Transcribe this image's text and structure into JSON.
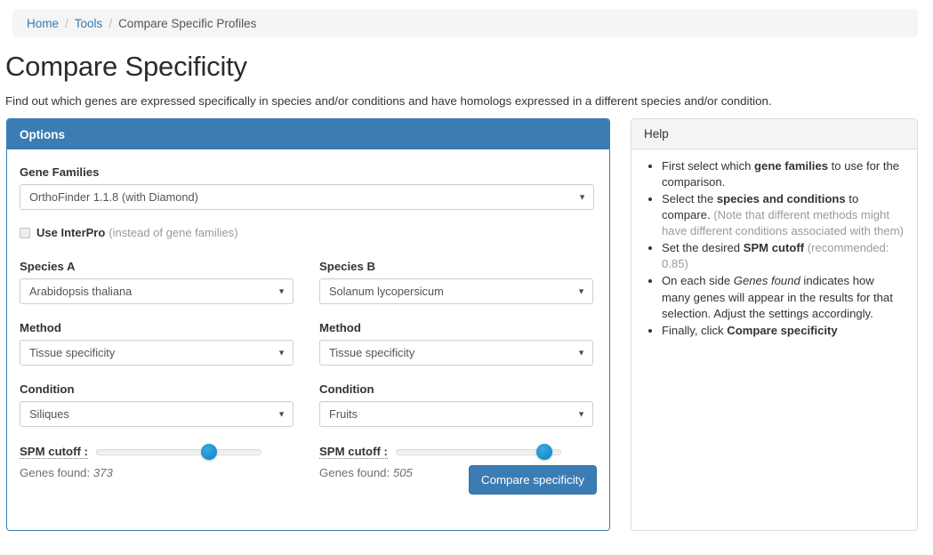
{
  "breadcrumb": {
    "home": "Home",
    "tools": "Tools",
    "current": "Compare Specific Profiles",
    "separator": "/"
  },
  "page": {
    "title": "Compare Specificity",
    "description": "Find out which genes are expressed specifically in species and/or conditions and have homologs expressed in a different species and/or condition."
  },
  "options": {
    "header": "Options",
    "gene_families": {
      "label": "Gene Families",
      "value": "OrthoFinder 1.1.8 (with Diamond)"
    },
    "interpro": {
      "label": "Use InterPro",
      "note": "(instead of gene families)",
      "checked": false
    },
    "side_a": {
      "species_label": "Species A",
      "species_value": "Arabidopsis thaliana",
      "method_label": "Method",
      "method_value": "Tissue specificity",
      "condition_label": "Condition",
      "condition_value": "Siliques",
      "spm_label": "SPM cutoff :",
      "spm_percent": 70,
      "genes_found_label": "Genes found:",
      "genes_found_value": "373"
    },
    "side_b": {
      "species_label": "Species B",
      "species_value": "Solanum lycopersicum",
      "method_label": "Method",
      "method_value": "Tissue specificity",
      "condition_label": "Condition",
      "condition_value": "Fruits",
      "spm_label": "SPM cutoff :",
      "spm_percent": 94,
      "genes_found_label": "Genes found:",
      "genes_found_value": "505"
    },
    "submit_label": "Compare specificity",
    "caret_glyph": "▼"
  },
  "help": {
    "header": "Help",
    "items": [
      {
        "prefix": "First select which ",
        "strong": "gene families",
        "suffix": " to use for the comparison.",
        "muted": ""
      },
      {
        "prefix": "Select the ",
        "strong": "species and conditions",
        "suffix": " to compare.",
        "muted": "(Note that different methods might have different conditions associated with them)"
      },
      {
        "prefix": "Set the desired ",
        "strong": "SPM cutoff",
        "suffix": "",
        "muted": "(recommended: 0.85)"
      },
      {
        "prefix": "On each side ",
        "em": "Genes found",
        "suffix": " indicates how many genes will appear in the results for that selection. Adjust the settings accordingly.",
        "muted": ""
      },
      {
        "prefix": "Finally, click ",
        "strong": "Compare specificity",
        "suffix": "",
        "muted": ""
      }
    ]
  },
  "colors": {
    "brand_blue": "#3b7cb5",
    "link_blue": "#337ab7",
    "slider_blue": "#1a8fd0",
    "panel_gray": "#f5f5f5"
  }
}
